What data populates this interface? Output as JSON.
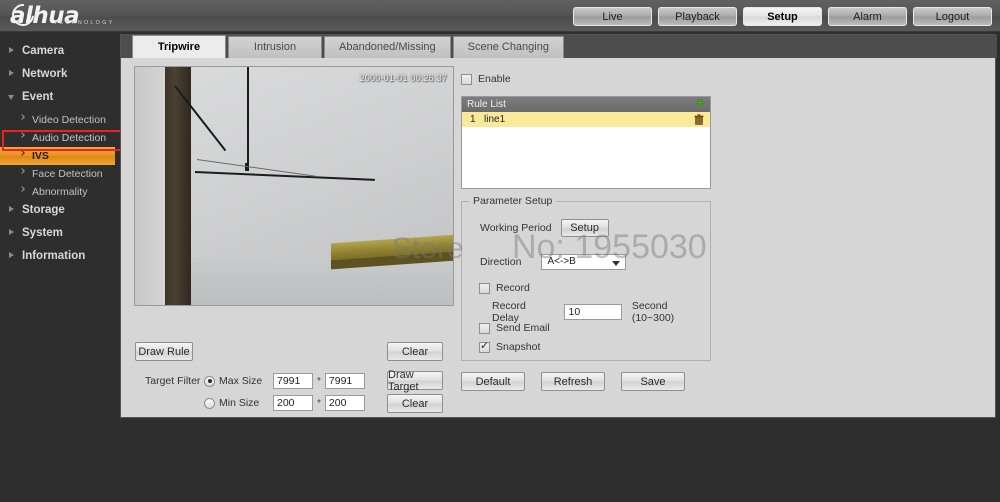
{
  "brand": {
    "name": "alhua",
    "tagline": "TECHNOLOGY"
  },
  "topnav": {
    "items": [
      {
        "label": "Live",
        "active": false
      },
      {
        "label": "Playback",
        "active": false
      },
      {
        "label": "Setup",
        "active": true
      },
      {
        "label": "Alarm",
        "active": false
      },
      {
        "label": "Logout",
        "active": false
      }
    ]
  },
  "sidebar": {
    "items": [
      {
        "label": "Camera",
        "level": "top",
        "expanded": false
      },
      {
        "label": "Network",
        "level": "top",
        "expanded": false
      },
      {
        "label": "Event",
        "level": "top",
        "expanded": true
      },
      {
        "label": "Video Detection",
        "level": "sub",
        "selected": false
      },
      {
        "label": "Audio Detection",
        "level": "sub",
        "selected": false
      },
      {
        "label": "IVS",
        "level": "sub",
        "selected": true
      },
      {
        "label": "Face Detection",
        "level": "sub",
        "selected": false
      },
      {
        "label": "Abnormality",
        "level": "sub",
        "selected": false
      },
      {
        "label": "Storage",
        "level": "top",
        "expanded": false
      },
      {
        "label": "System",
        "level": "top",
        "expanded": false
      },
      {
        "label": "Information",
        "level": "top",
        "expanded": false
      }
    ],
    "highlight_color": "#ef2020",
    "selected_color": "#e8921f"
  },
  "tabs": [
    {
      "label": "Tripwire",
      "active": true
    },
    {
      "label": "Intrusion",
      "active": false
    },
    {
      "label": "Abandoned/Missing",
      "active": false
    },
    {
      "label": "Scene Changing",
      "active": false
    }
  ],
  "help": {
    "icon": "help-icon",
    "glyph": "?"
  },
  "video": {
    "timestamp": "2000-01-01 00:26:37",
    "corner_text": ""
  },
  "left_controls": {
    "draw_rule": "Draw Rule",
    "clear_rule": "Clear",
    "target_filter_label": "Target Filter",
    "max_size": {
      "label": "Max Size",
      "selected": true,
      "width": "7991",
      "height": "7991"
    },
    "min_size": {
      "label": "Min Size",
      "selected": false,
      "width": "200",
      "height": "200"
    },
    "separator": "*",
    "draw_target": "Draw Target",
    "clear_target": "Clear"
  },
  "right_panel": {
    "enable": {
      "label": "Enable",
      "checked": false
    },
    "rule_list": {
      "title": "Rule List",
      "add_icon": "add-icon",
      "rows": [
        {
          "index": "1",
          "name": "line1",
          "delete_icon": "delete-icon"
        }
      ]
    },
    "parameter_setup": {
      "legend": "Parameter Setup",
      "working_period": {
        "label": "Working Period",
        "button": "Setup"
      },
      "direction": {
        "label": "Direction",
        "value": "A<->B"
      },
      "record": {
        "label": "Record",
        "checked": false
      },
      "record_delay": {
        "label": "Record Delay",
        "value": "10",
        "unit": "Second (10~300)"
      },
      "send_email": {
        "label": "Send Email",
        "checked": false
      },
      "snapshot": {
        "label": "Snapshot",
        "checked": true
      }
    },
    "actions": [
      {
        "label": "Default"
      },
      {
        "label": "Refresh"
      },
      {
        "label": "Save"
      }
    ]
  },
  "watermark": {
    "part1": "Store",
    "part2": "No: 1955030"
  }
}
